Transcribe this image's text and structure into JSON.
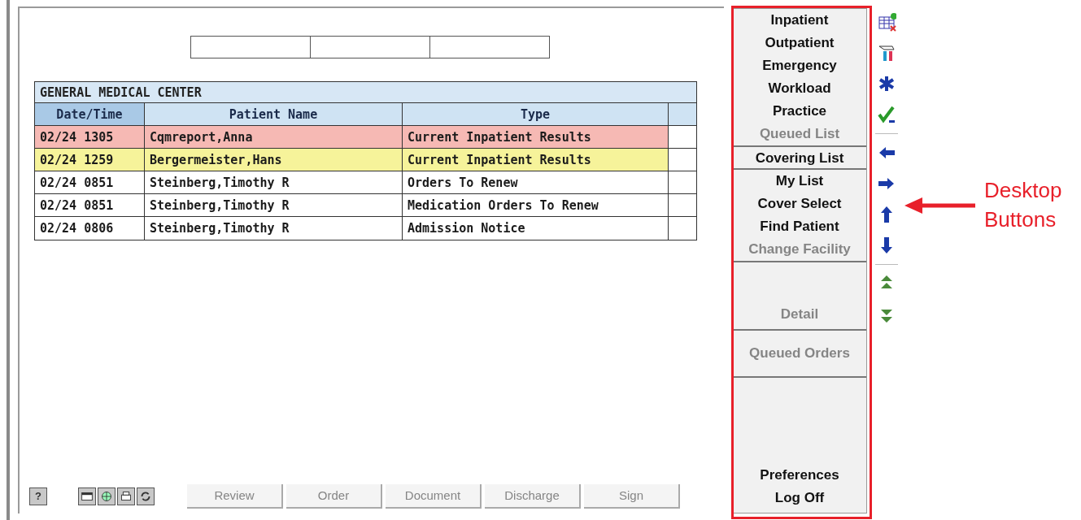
{
  "patient_list": {
    "title": "GENERAL MEDICAL CENTER",
    "columns": [
      "Date/Time",
      "Patient Name",
      "Type"
    ],
    "rows": [
      {
        "date_time": "02/24 1305",
        "patient_name": "Cqmreport,Anna",
        "type": "Current Inpatient Results",
        "color": "#f6b9b4"
      },
      {
        "date_time": "02/24 1259",
        "patient_name": "Bergermeister,Hans",
        "type": "Current Inpatient Results",
        "color": "#f6f39a"
      },
      {
        "date_time": "02/24 0851",
        "patient_name": "Steinberg,Timothy R",
        "type": "Orders To Renew"
      },
      {
        "date_time": "02/24 0851",
        "patient_name": "Steinberg,Timothy R",
        "type": "Medication Orders To Renew"
      },
      {
        "date_time": "02/24 0806",
        "patient_name": "Steinberg,Timothy R",
        "type": "Admission Notice"
      }
    ]
  },
  "bottom_bar": {
    "help_button": "?",
    "buttons": [
      {
        "label": "Review",
        "disabled": true
      },
      {
        "label": "Order",
        "disabled": true
      },
      {
        "label": "Document",
        "disabled": true
      },
      {
        "label": "Discharge",
        "disabled": true
      },
      {
        "label": "Sign",
        "disabled": true
      }
    ]
  },
  "desktop_buttons": [
    {
      "kind": "stack",
      "items": [
        {
          "label": "Inpatient",
          "disabled": false
        },
        {
          "label": "Outpatient",
          "disabled": false
        },
        {
          "label": "Emergency",
          "disabled": false
        },
        {
          "label": "Workload",
          "disabled": false
        },
        {
          "label": "Practice",
          "disabled": false
        },
        {
          "label": "Queued List",
          "disabled": true
        }
      ]
    },
    {
      "kind": "stack",
      "items": [
        {
          "label": "Covering List",
          "disabled": false
        }
      ]
    },
    {
      "kind": "stack",
      "items": [
        {
          "label": "My List",
          "disabled": false
        },
        {
          "label": "Cover Select",
          "disabled": false
        },
        {
          "label": "Find Patient",
          "disabled": false
        },
        {
          "label": "Change Facility",
          "disabled": true
        }
      ]
    },
    {
      "kind": "bottom",
      "items": [
        {
          "label": "Detail",
          "disabled": true
        }
      ]
    },
    {
      "kind": "center",
      "items": [
        {
          "label": "Queued Orders",
          "disabled": true
        }
      ]
    },
    {
      "kind": "bottom",
      "items": [
        {
          "label": "Preferences",
          "disabled": false
        },
        {
          "label": "Log Off",
          "disabled": false
        }
      ]
    }
  ],
  "annotation": {
    "label": "Desktop Buttons"
  }
}
